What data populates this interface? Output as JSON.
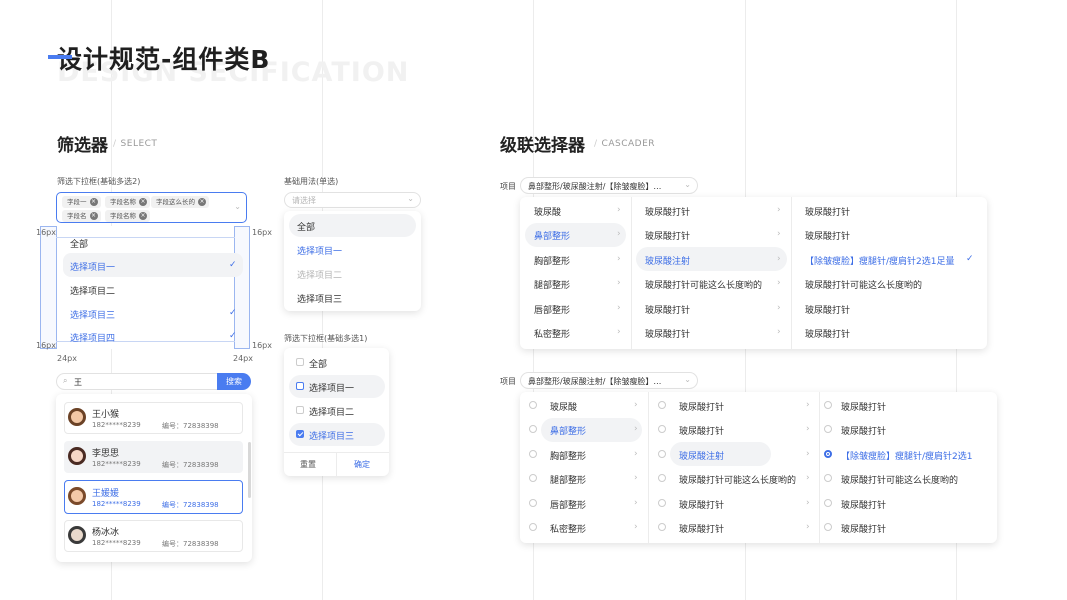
{
  "header": {
    "title": "设计规范-组件类B",
    "subtitle": "DESIGN SECIFICATION"
  },
  "select_section": {
    "title": "筛选器",
    "subtitle": "SELECT",
    "multi_dropdown": {
      "label": "筛选下拉框(基础多选2)",
      "tags": [
        "字段一",
        "字段名称",
        "字段这么长的",
        "字段名",
        "字段名称"
      ],
      "options": [
        "全部",
        "选择项目一",
        "选择项目二",
        "选择项目三",
        "选择项目四"
      ],
      "selected": [
        false,
        true,
        false,
        true,
        true
      ],
      "measures": {
        "m16": "16px",
        "m24": "24px"
      }
    },
    "single_dropdown": {
      "label": "基础用法(单选)",
      "placeholder": "请选择",
      "options": [
        "全部",
        "选择项目一",
        "选择项目二",
        "选择项目三"
      ]
    },
    "multi_check": {
      "label": "筛选下拉框(基础多选1)",
      "options": [
        "全部",
        "选择项目一",
        "选择项目二",
        "选择项目三"
      ],
      "reset": "重置",
      "confirm": "确定"
    },
    "user_search": {
      "query": "王",
      "button": "搜索",
      "users": [
        {
          "name": "王小猴",
          "phone": "182*****8239",
          "code": "编号：72838398"
        },
        {
          "name": "李思思",
          "phone": "182*****8239",
          "code": "编号：72838398"
        },
        {
          "name": "王媛媛",
          "phone": "182*****8239",
          "code": "编号：72838398"
        },
        {
          "name": "杨冰冰",
          "phone": "182*****8239",
          "code": "编号：72838398"
        }
      ]
    }
  },
  "cascader_section": {
    "title": "级联选择器",
    "subtitle": "CASCADER",
    "label": "项目",
    "value": "鼻部整形/玻尿酸注射/【除皱瘦脸】…",
    "col1": [
      "玻尿酸",
      "鼻部整形",
      "胸部整形",
      "腿部整形",
      "唇部整形",
      "私密整形"
    ],
    "col2": [
      "玻尿酸打针",
      "玻尿酸打针",
      "玻尿酸注射",
      "玻尿酸打针可能这么长度哟的",
      "玻尿酸打针",
      "玻尿酸打针"
    ],
    "col3_a": [
      "玻尿酸打针",
      "玻尿酸打针",
      "【除皱瘦脸】瘦腿针/瘦肩针2选1足量",
      "玻尿酸打针可能这么长度哟的",
      "玻尿酸打针",
      "玻尿酸打针"
    ],
    "col3_b": [
      "玻尿酸打针",
      "玻尿酸打针",
      "【除皱瘦脸】瘦腿针/瘦肩针2选1",
      "玻尿酸打针可能这么长度哟的",
      "玻尿酸打针",
      "玻尿酸打针"
    ]
  },
  "colors": {
    "accent": "#3d6ee6",
    "accent_light": "#4a7cf0",
    "hover_bg": "#f2f3f5"
  },
  "icons": {
    "check": "check-icon",
    "chevron": "chevron-right-icon",
    "search": "search-icon",
    "close": "close-icon"
  }
}
